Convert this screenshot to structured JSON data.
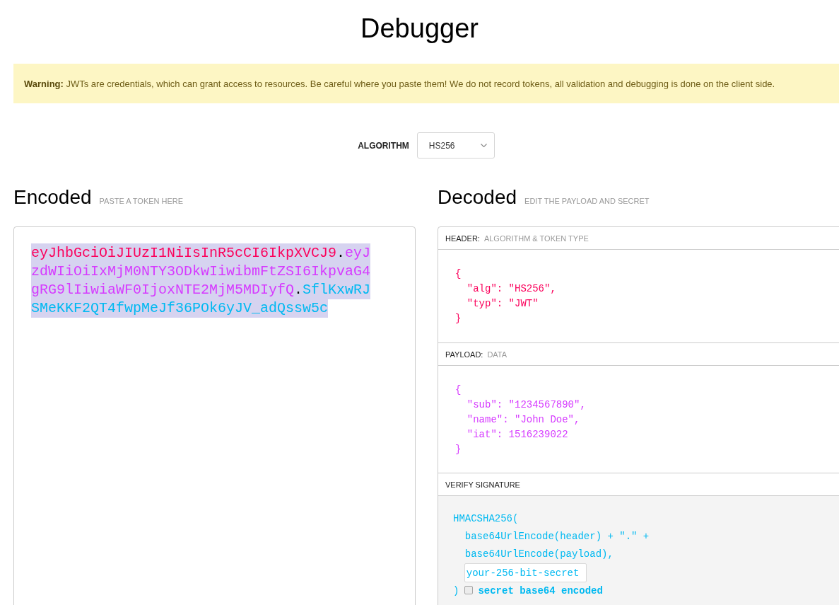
{
  "page": {
    "title": "Debugger"
  },
  "warning": {
    "text": "**Warning:** JWTs are credentials, which can grant access to resources. Be careful where you paste them! We do not record tokens, all validation and debugging is done on the client side."
  },
  "algorithm": {
    "label": "ALGORITHM",
    "value": "HS256"
  },
  "encoded": {
    "title": "Encoded",
    "hint": "PASTE A TOKEN HERE",
    "highlighted": true,
    "token": [
      {
        "kind": "header",
        "text": "eyJhbGciOiJIUzI1NiIsInR5cCI6IkpXVCJ9"
      },
      {
        "kind": "separator",
        "text": "."
      },
      {
        "kind": "payload",
        "text": "eyJzdWIiOiIxMjM0NTY3ODkwIiwibmFtZSI6IkpvaG4gRG9lIiwiaWF0IjoxNTE2MjM5MDIyfQ"
      },
      {
        "kind": "separator",
        "text": "."
      },
      {
        "kind": "signature",
        "text": "SflKxwRJSMeKKF2QT4fwpMeJf36POk6yJV_adQssw5c"
      }
    ]
  },
  "decoded": {
    "title": "Decoded",
    "hint": "EDIT THE PAYLOAD AND SECRET",
    "sections": [
      {
        "kind": "header",
        "label": "HEADER:",
        "caption": "ALGORITHM & TOKEN TYPE",
        "lines": [
          {
            "text": "{",
            "children": [
              {
                "text": "\"alg\": \"HS256\","
              },
              {
                "text": "\"typ\": \"JWT\""
              }
            ]
          },
          {
            "text": "}"
          }
        ]
      },
      {
        "kind": "payload",
        "label": "PAYLOAD:",
        "caption": "DATA",
        "lines": [
          {
            "text": "{",
            "children": [
              {
                "text": "\"sub\": \"1234567890\","
              },
              {
                "text": "\"name\": \"John Doe\","
              },
              {
                "text": "\"iat\": 1516239022"
              }
            ]
          },
          {
            "text": "}"
          }
        ]
      },
      {
        "kind": "signature",
        "label": "VERIFY SIGNATURE",
        "function": "HMACSHA256(",
        "args": [
          "base64UrlEncode(header) + \".\" +",
          "base64UrlEncode(payload),"
        ],
        "secret": {
          "value": "your-256-bit-secret"
        },
        "close": ")",
        "base64": {
          "label": "secret base64 encoded",
          "checked": false
        }
      }
    ]
  }
}
